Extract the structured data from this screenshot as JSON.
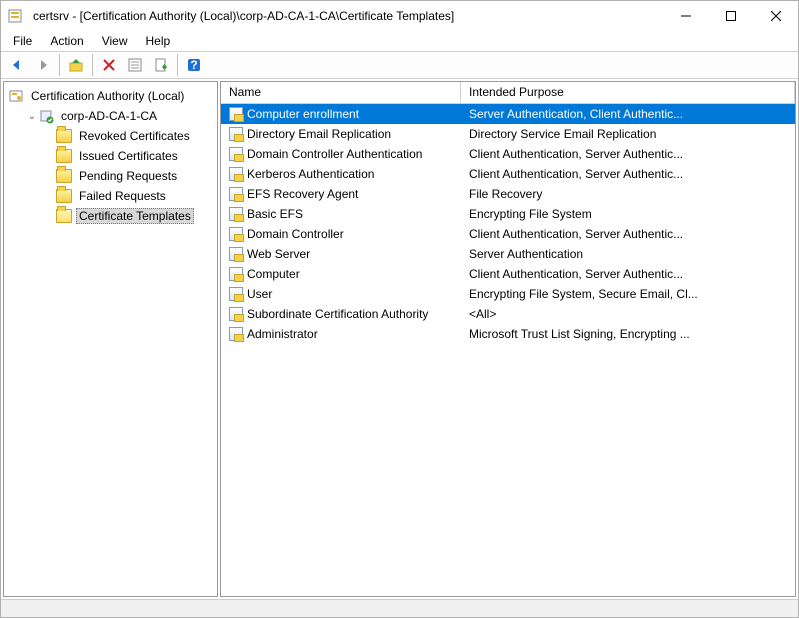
{
  "title": "certsrv - [Certification Authority (Local)\\corp-AD-CA-1-CA\\Certificate Templates]",
  "menubar": {
    "file": "File",
    "action": "Action",
    "view": "View",
    "help": "Help"
  },
  "tree": {
    "root": "Certification Authority (Local)",
    "ca": "corp-AD-CA-1-CA",
    "nodes": [
      "Revoked Certificates",
      "Issued Certificates",
      "Pending Requests",
      "Failed Requests",
      "Certificate Templates"
    ],
    "selected": "Certificate Templates"
  },
  "list": {
    "columns": {
      "name": "Name",
      "purpose": "Intended Purpose"
    },
    "rows": [
      {
        "name": "Computer enrollment",
        "purpose": "Server Authentication, Client Authentic...",
        "selected": true
      },
      {
        "name": "Directory Email Replication",
        "purpose": "Directory Service Email Replication"
      },
      {
        "name": "Domain Controller Authentication",
        "purpose": "Client Authentication, Server Authentic..."
      },
      {
        "name": "Kerberos Authentication",
        "purpose": "Client Authentication, Server Authentic..."
      },
      {
        "name": "EFS Recovery Agent",
        "purpose": "File Recovery"
      },
      {
        "name": "Basic EFS",
        "purpose": "Encrypting File System"
      },
      {
        "name": "Domain Controller",
        "purpose": "Client Authentication, Server Authentic..."
      },
      {
        "name": "Web Server",
        "purpose": "Server Authentication"
      },
      {
        "name": "Computer",
        "purpose": "Client Authentication, Server Authentic..."
      },
      {
        "name": "User",
        "purpose": "Encrypting File System, Secure Email, Cl..."
      },
      {
        "name": "Subordinate Certification Authority",
        "purpose": "<All>"
      },
      {
        "name": "Administrator",
        "purpose": "Microsoft Trust List Signing, Encrypting ..."
      }
    ]
  }
}
